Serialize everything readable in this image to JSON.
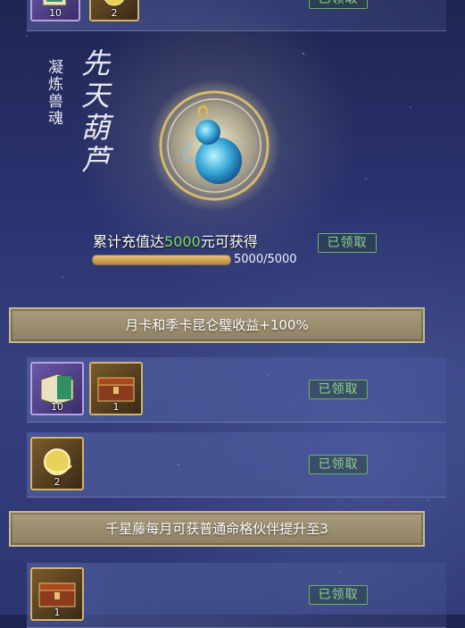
{
  "top_row": {
    "items": [
      {
        "icon": "book-icon",
        "count": "10"
      },
      {
        "icon": "gold-orb-icon",
        "count": "2"
      }
    ],
    "status": "已领取"
  },
  "featured": {
    "section_label": "凝炼兽魂",
    "reward_name": "先天葫芦",
    "condition_prefix": "累计充值达",
    "condition_amount": "5000",
    "condition_suffix": "元可获得",
    "progress_text": "5000/5000",
    "progress_fraction": 1.0,
    "status": "已领取",
    "icon": "gourd-icon"
  },
  "sections": [
    {
      "banner": "月卡和季卡昆仑璧收益+100%",
      "rows": [
        {
          "items": [
            {
              "icon": "book-icon",
              "count": "10"
            },
            {
              "icon": "chest-icon",
              "count": "1"
            }
          ],
          "status": "已领取"
        },
        {
          "items": [
            {
              "icon": "gold-orb-icon",
              "count": "2"
            }
          ],
          "status": "已领取"
        }
      ]
    },
    {
      "banner": "千星藤每月可获普通命格伙伴提升至3",
      "rows": [
        {
          "items": [
            {
              "icon": "chest-icon",
              "count": "1"
            }
          ],
          "status": "已领取"
        }
      ]
    }
  ],
  "colors": {
    "highlight": "#7fe06a",
    "claimed_green": "#8fd38a",
    "gold": "#d2b46a"
  }
}
